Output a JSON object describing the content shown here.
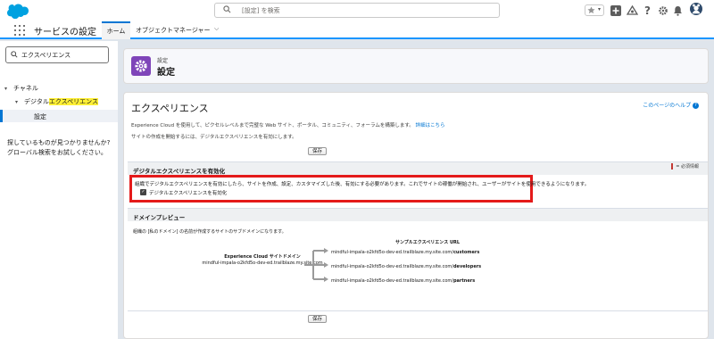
{
  "top": {
    "search_placeholder": "[設定] を検索"
  },
  "nav": {
    "app_name": "サービスの設定",
    "tab_home": "ホーム",
    "tab_object_manager": "オブジェクトマネージャー"
  },
  "sidebar": {
    "quick_find_value": "エクスペリエンス",
    "tree": {
      "channel": "チャネル",
      "digital_prefix": "デジタル",
      "digital_highlight": "エクスペリエンス",
      "settings": "設定"
    },
    "help_line1": "探しているものが見つかりませんか?",
    "help_line2": "グローバル検索をお試しください。"
  },
  "header": {
    "small": "設定",
    "title": "設定"
  },
  "main": {
    "title": "エクスペリエンス",
    "help_link": "このページのヘルプ",
    "desc1": "Experience Cloud を使用して、ピクセルレベルまで完璧な Web サイト、ポータル、コミュニティ、フォーラムを構築します。",
    "desc1_link": "詳細はこちら",
    "desc2": "サイトの作成を開始するには、デジタルエクスペリエンスを有効にします。",
    "save_label": "保存",
    "required_label": "= 必須情報",
    "section_enable": "デジタルエクスペリエンスを有効化",
    "enable_info": "組織でデジタルエクスペリエンスを有効にしたら、サイトを作成、設定、カスタマイズした後、有効にする必要があります。これでサイトの稼働が開始され、ユーザーがサイトを使用できるようになります。",
    "checkbox_label": "デジタルエクスペリエンスを有効化",
    "section_domain": "ドメインプレビュー",
    "domain_desc": "組織の [私のドメイン] の名前が作成するサイトのサブドメインになります。",
    "site_domain_title": "Experience Cloud サイトドメイン",
    "site_domain_value": "mindful-impala-o2kfd5o-dev-ed.trailblaze.my.site.com",
    "sample_title": "サンプルエクスペリエンス URL",
    "samples": [
      {
        "base": "mindful-impala-o2kfd5o-dev-ed.trailblaze.my.site.com/",
        "path": "customers"
      },
      {
        "base": "mindful-impala-o2kfd5o-dev-ed.trailblaze.my.site.com/",
        "path": "developers"
      },
      {
        "base": "mindful-impala-o2kfd5o-dev-ed.trailblaze.my.site.com/",
        "path": "partners"
      }
    ]
  }
}
